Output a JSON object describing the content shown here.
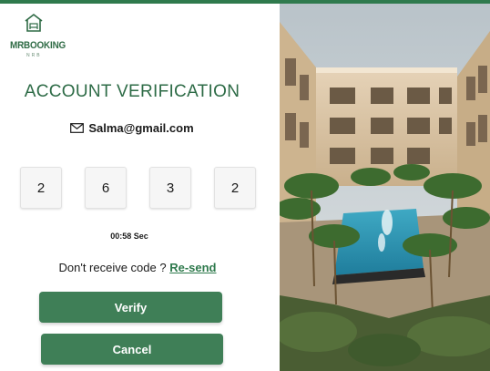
{
  "brand": {
    "name": "MRBOOKING",
    "tagline": "NRB",
    "accent_color": "#2f7a4d",
    "logo_icon": "house-bed-icon"
  },
  "verification": {
    "title": "ACCOUNT VERIFICATION",
    "email_icon": "envelope-icon",
    "email": "Salma@gmail.com",
    "code_digits": [
      "2",
      "6",
      "3",
      "2"
    ],
    "timer": "00:58 Sec",
    "resend_prompt": "Don't receive code ? ",
    "resend_link": "Re-send",
    "verify_label": "Verify",
    "cancel_label": "Cancel"
  },
  "hero_image": {
    "subject": "hotel-courtyard-pool-photo"
  }
}
